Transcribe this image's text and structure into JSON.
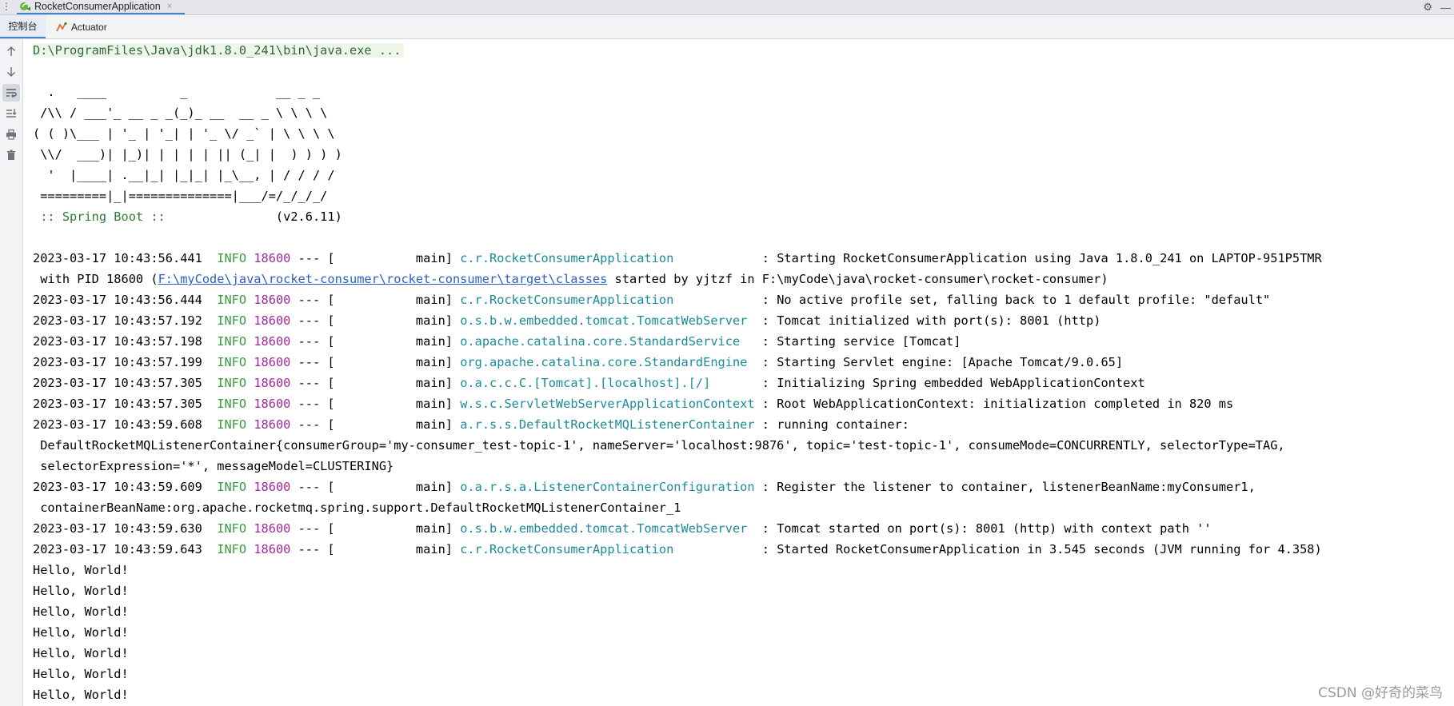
{
  "run_tab": {
    "title": "RocketConsumerApplication",
    "close": "×"
  },
  "sub_tabs": {
    "console": "控制台",
    "actuator": "Actuator"
  },
  "console": {
    "command": "D:\\ProgramFiles\\Java\\jdk1.8.0_241\\bin\\java.exe ...",
    "banner": [
      "  .   ____          _            __ _ _",
      " /\\\\ / ___'_ __ _ _(_)_ __  __ _ \\ \\ \\ \\",
      "( ( )\\___ | '_ | '_| | '_ \\/ _` | \\ \\ \\ \\",
      " \\\\/  ___)| |_)| | | | | || (_| |  ) ) ) )",
      "  '  |____| .__|_| |_|_| |_\\__, | / / / /",
      " =========|_|==============|___/=/_/_/_/"
    ],
    "spring_label": " :: Spring Boot :: ",
    "spring_version": "              (v2.6.11)",
    "logs": [
      {
        "time": "2023-03-17 10:43:56.441",
        "level": "INFO",
        "pid": "18600",
        "sep": " --- [           main] ",
        "logger": "c.r.RocketConsumerApplication           ",
        "message": " : Starting RocketConsumerApplication using Java 1.8.0_241 on LAPTOP-951P5TMR"
      },
      {
        "time": "2023-03-17 10:43:56.444",
        "level": "INFO",
        "pid": "18600",
        "sep": " --- [           main] ",
        "logger": "c.r.RocketConsumerApplication           ",
        "message": " : No active profile set, falling back to 1 default profile: \"default\""
      },
      {
        "time": "2023-03-17 10:43:57.192",
        "level": "INFO",
        "pid": "18600",
        "sep": " --- [           main] ",
        "logger": "o.s.b.w.embedded.tomcat.TomcatWebServer ",
        "message": " : Tomcat initialized with port(s): 8001 (http)"
      },
      {
        "time": "2023-03-17 10:43:57.198",
        "level": "INFO",
        "pid": "18600",
        "sep": " --- [           main] ",
        "logger": "o.apache.catalina.core.StandardService  ",
        "message": " : Starting service [Tomcat]"
      },
      {
        "time": "2023-03-17 10:43:57.199",
        "level": "INFO",
        "pid": "18600",
        "sep": " --- [           main] ",
        "logger": "org.apache.catalina.core.StandardEngine ",
        "message": " : Starting Servlet engine: [Apache Tomcat/9.0.65]"
      },
      {
        "time": "2023-03-17 10:43:57.305",
        "level": "INFO",
        "pid": "18600",
        "sep": " --- [           main] ",
        "logger": "o.a.c.c.C.[Tomcat].[localhost].[/]      ",
        "message": " : Initializing Spring embedded WebApplicationContext"
      },
      {
        "time": "2023-03-17 10:43:57.305",
        "level": "INFO",
        "pid": "18600",
        "sep": " --- [           main] ",
        "logger": "w.s.c.ServletWebServerApplicationContext",
        "message": " : Root WebApplicationContext: initialization completed in 820 ms"
      },
      {
        "time": "2023-03-17 10:43:59.608",
        "level": "INFO",
        "pid": "18600",
        "sep": " --- [           main] ",
        "logger": "a.r.s.s.DefaultRocketMQListenerContainer",
        "message": " : running container:"
      },
      {
        "time": "2023-03-17 10:43:59.609",
        "level": "INFO",
        "pid": "18600",
        "sep": " --- [           main] ",
        "logger": "o.a.r.s.a.ListenerContainerConfiguration",
        "message": " : Register the listener to container, listenerBeanName:myConsumer1,"
      },
      {
        "time": "2023-03-17 10:43:59.630",
        "level": "INFO",
        "pid": "18600",
        "sep": " --- [           main] ",
        "logger": "o.s.b.w.embedded.tomcat.TomcatWebServer ",
        "message": " : Tomcat started on port(s): 8001 (http) with context path ''"
      },
      {
        "time": "2023-03-17 10:43:59.643",
        "level": "INFO",
        "pid": "18600",
        "sep": " --- [           main] ",
        "logger": "c.r.RocketConsumerApplication           ",
        "message": " : Started RocketConsumerApplication in 3.545 seconds (JVM running for 4.358)"
      }
    ],
    "continuations": {
      "pid_prefix": " with PID 18600 (",
      "pid_link": "F:\\myCode\\java\\rocket-consumer\\rocket-consumer\\target\\classes",
      "pid_suffix": " started by yjtzf in F:\\myCode\\java\\rocket-consumer\\rocket-consumer)",
      "container_1": " DefaultRocketMQListenerContainer{consumerGroup='my-consumer_test-topic-1', nameServer='localhost:9876', topic='test-topic-1', consumeMode=CONCURRENTLY, selectorType=TAG,",
      "container_2": " selectorExpression='*', messageModel=CLUSTERING}",
      "register_1": " containerBeanName:org.apache.rocketmq.spring.support.DefaultRocketMQListenerContainer_1"
    },
    "hello": [
      "Hello, World!",
      "Hello, World!",
      "Hello, World!",
      "Hello, World!",
      "Hello, World!",
      "Hello, World!",
      "Hello, World!"
    ]
  },
  "watermark": "CSDN @好奇的菜鸟"
}
